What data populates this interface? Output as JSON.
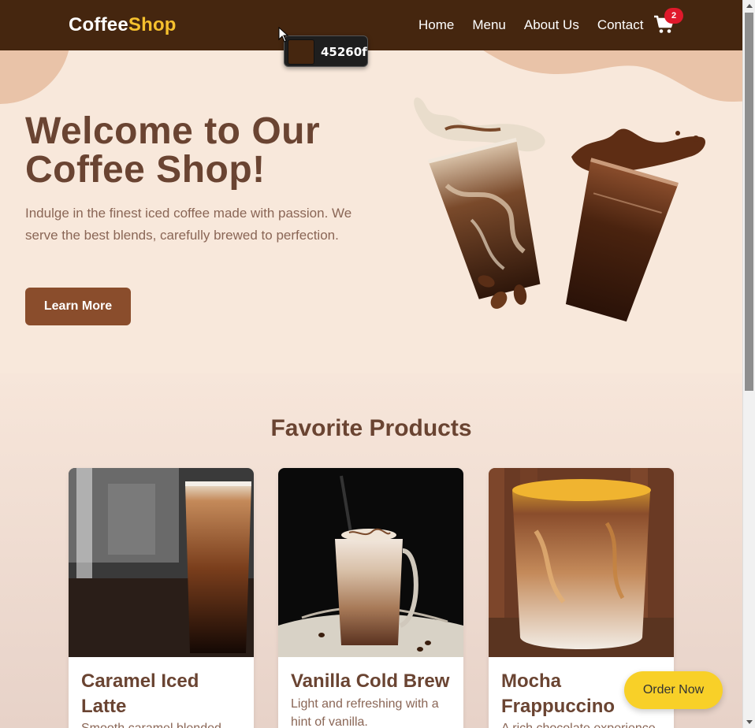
{
  "nav": {
    "logo_part1": "Coffee",
    "logo_part2": "Shop",
    "links": [
      "Home",
      "Menu",
      "About Us",
      "Contact"
    ],
    "cart_count": "2",
    "cart_icon": "cart-icon"
  },
  "color_picker": {
    "hex": "45260f",
    "swatch_color": "#45260f"
  },
  "hero": {
    "title_line1": "Welcome to Our",
    "title_line2": "Coffee Shop!",
    "text": "Indulge in the finest iced coffee made with passion. We serve the best blends, carefully brewed to perfection.",
    "button": "Learn More"
  },
  "products": {
    "title": "Favorite Products",
    "items": [
      {
        "name": "Caramel Iced Latte",
        "desc": "Smooth caramel blended"
      },
      {
        "name": "Vanilla Cold Brew",
        "desc": "Light and refreshing with a hint of vanilla."
      },
      {
        "name": "Mocha Frappuccino",
        "desc": "A rich chocolate experience"
      }
    ]
  },
  "order_button": "Order Now",
  "colors": {
    "nav_bg": "#45260f",
    "accent_yellow": "#f6c12e",
    "primary_brown": "#8a4d2c",
    "heading_brown": "#6a4432",
    "badge_red": "#e0192b",
    "order_yellow": "#f8d028"
  }
}
